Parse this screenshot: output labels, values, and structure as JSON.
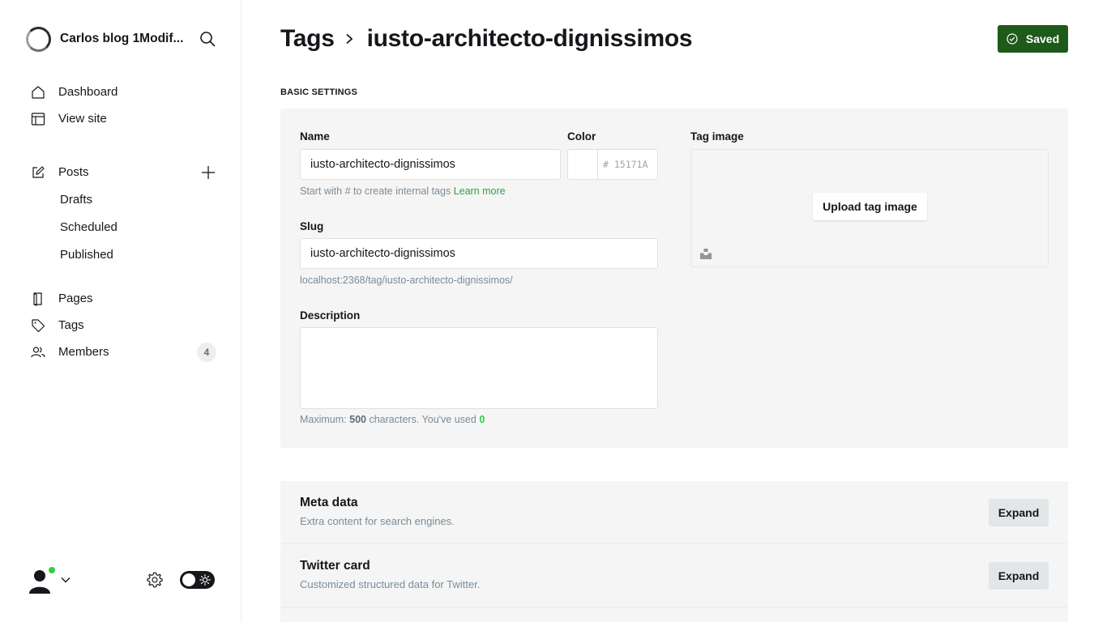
{
  "site": {
    "title": "Carlos blog 1Modif..."
  },
  "nav": {
    "dashboard": "Dashboard",
    "view_site": "View site",
    "posts": "Posts",
    "drafts": "Drafts",
    "scheduled": "Scheduled",
    "published": "Published",
    "pages": "Pages",
    "tags": "Tags",
    "members": "Members",
    "members_count": "4"
  },
  "header": {
    "breadcrumb_parent": "Tags",
    "breadcrumb_current": "iusto-architecto-dignissimos",
    "saved_label": "Saved"
  },
  "basic_settings": {
    "section_label": "BASIC SETTINGS",
    "name_label": "Name",
    "name_value": "iusto-architecto-dignissimos",
    "name_hint_prefix": "Start with # to create internal tags",
    "name_hint_link": "Learn more",
    "color_label": "Color",
    "color_value": "# 15171A",
    "slug_label": "Slug",
    "slug_value": "iusto-architecto-dignissimos",
    "slug_url": "localhost:2368/tag/iusto-architecto-dignissimos/",
    "description_label": "Description",
    "description_value": "",
    "desc_hint_prefix": "Maximum:",
    "desc_max": "500",
    "desc_hint_middle": "characters. You've used",
    "desc_used": "0",
    "tag_image_label": "Tag image",
    "upload_label": "Upload tag image"
  },
  "sections": [
    {
      "title": "Meta data",
      "description": "Extra content for search engines.",
      "button": "Expand"
    },
    {
      "title": "Twitter card",
      "description": "Customized structured data for Twitter.",
      "button": "Expand"
    }
  ],
  "colors": {
    "saved_bg": "#1e5a1a",
    "link_green": "#30a046",
    "online": "#30cf43"
  },
  "icons": [
    "site-logo-icon",
    "search-icon",
    "home-icon",
    "layout-icon",
    "edit-icon",
    "plus-icon",
    "page-icon",
    "tag-icon",
    "members-icon",
    "user-avatar-icon",
    "chevron-down-icon",
    "gear-icon",
    "sun-icon",
    "check-circle-icon",
    "chevron-right-icon",
    "unsplash-icon"
  ]
}
